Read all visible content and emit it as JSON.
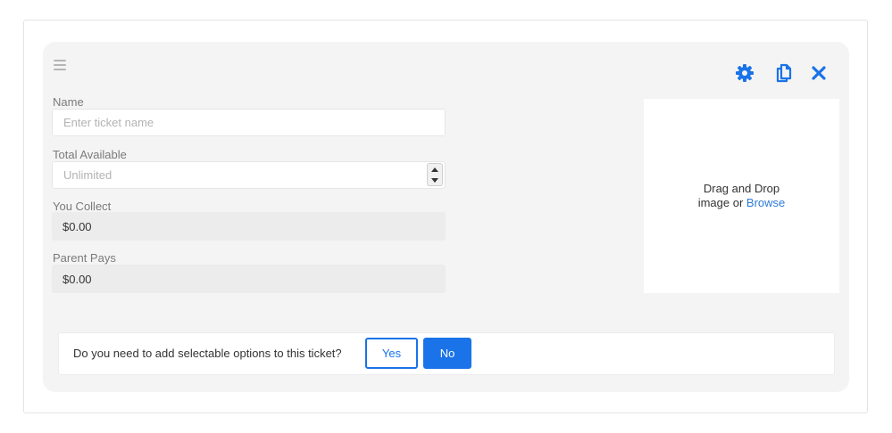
{
  "form": {
    "name": {
      "label": "Name",
      "placeholder": "Enter ticket name",
      "value": ""
    },
    "total_available": {
      "label": "Total Available",
      "placeholder": "Unlimited",
      "value": ""
    },
    "you_collect": {
      "label": "You Collect",
      "value": "$0.00"
    },
    "parent_pays": {
      "label": "Parent Pays",
      "value": "$0.00"
    }
  },
  "toolbar": {
    "icons": [
      "gear-icon",
      "copy-icon",
      "close-icon"
    ],
    "accent_color": "#1a73e8"
  },
  "dropzone": {
    "line1": "Drag and Drop",
    "line2_prefix": "image or ",
    "browse_label": "Browse"
  },
  "options": {
    "question": "Do you need to add selectable options to this ticket?",
    "yes_label": "Yes",
    "no_label": "No"
  }
}
